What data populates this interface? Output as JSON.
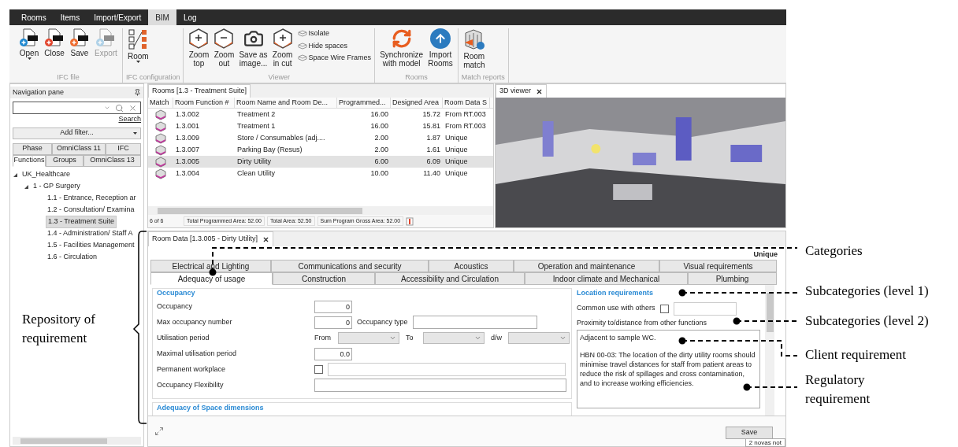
{
  "app_tabs": [
    {
      "label": "Rooms",
      "selected": false
    },
    {
      "label": "Items",
      "selected": false
    },
    {
      "label": "Import/Export",
      "selected": false
    },
    {
      "label": "BIM",
      "selected": true
    },
    {
      "label": "Log",
      "selected": false
    }
  ],
  "ribbon": {
    "groups": [
      {
        "title": "IFC file",
        "buttons": [
          {
            "label": "Open",
            "dropdown": true,
            "disabled": false
          },
          {
            "label": "Close",
            "dropdown": false,
            "disabled": false
          },
          {
            "label": "Save",
            "dropdown": false,
            "disabled": false
          },
          {
            "label": "Export",
            "dropdown": false,
            "disabled": true
          }
        ]
      },
      {
        "title": "IFC configuration",
        "buttons": [
          {
            "label": "Room",
            "dropdown": true,
            "disabled": false
          }
        ]
      },
      {
        "title": "Viewer",
        "buttons": [
          {
            "label": "Zoom\ntop",
            "dropdown": false,
            "disabled": false
          },
          {
            "label": "Zoom\nout",
            "dropdown": false,
            "disabled": false
          },
          {
            "label": "Save as\nimage...",
            "dropdown": false,
            "disabled": false
          },
          {
            "label": "Zoom\nin cut",
            "dropdown": false,
            "disabled": false
          }
        ],
        "small_buttons": [
          "Isolate",
          "Hide spaces",
          "Space Wire Frames"
        ]
      },
      {
        "title": "Rooms",
        "buttons": [
          {
            "label": "Synchronize\nwith model",
            "dropdown": false,
            "disabled": false
          },
          {
            "label": "Import\nRooms",
            "dropdown": false,
            "disabled": false
          }
        ]
      },
      {
        "title": "Match reports",
        "buttons": [
          {
            "label": "Room\nmatch",
            "dropdown": false,
            "disabled": false
          }
        ]
      }
    ]
  },
  "nav": {
    "title": "Navigation pane",
    "search_link": "Search",
    "filter": "Add filter...",
    "tabs_row1": [
      {
        "label": "Phase",
        "selected": false
      },
      {
        "label": "OmniClass 11",
        "selected": false
      },
      {
        "label": "IFC",
        "selected": false
      }
    ],
    "tabs_row2": [
      {
        "label": "Functions",
        "selected": true
      },
      {
        "label": "Groups",
        "selected": false
      },
      {
        "label": "OmniClass 13",
        "selected": false
      }
    ],
    "tree": [
      {
        "label": "UK_Healthcare",
        "expanded": true,
        "selected": false,
        "children": [
          {
            "label": "1 - GP Surgery",
            "expanded": true,
            "selected": false,
            "children": [
              {
                "label": "1.1 - Entrance, Reception ar",
                "selected": false
              },
              {
                "label": "1.2 - Consultation/ Examina",
                "selected": false
              },
              {
                "label": "1.3 - Treatment Suite",
                "selected": true
              },
              {
                "label": "1.4 - Administration/ Staff A",
                "selected": false
              },
              {
                "label": "1.5 - Facilities Management",
                "selected": false
              },
              {
                "label": "1.6 - Circulation",
                "selected": false
              }
            ]
          }
        ]
      }
    ]
  },
  "rooms_panel": {
    "tab": "Rooms [1.3 - Treatment Suite]",
    "columns": [
      "Match",
      "Room Function #",
      "Room Name and Room De...",
      "Programmed...",
      "Designed Area",
      "Room Data S"
    ],
    "rows": [
      {
        "cells": [
          "",
          "1.3.002",
          "Treatment 2",
          "16.00",
          "15.72",
          "From RT.003"
        ],
        "selected": false
      },
      {
        "cells": [
          "",
          "1.3.001",
          "Treatment 1",
          "16.00",
          "15.81",
          "From RT.003"
        ],
        "selected": false
      },
      {
        "cells": [
          "",
          "1.3.009",
          "Store / Consumables (adj....",
          "2.00",
          "1.87",
          "Unique"
        ],
        "selected": false
      },
      {
        "cells": [
          "",
          "1.3.007",
          "Parking Bay (Resus)",
          "2.00",
          "1.61",
          "Unique"
        ],
        "selected": false
      },
      {
        "cells": [
          "",
          "1.3.005",
          "Dirty Utility",
          "6.00",
          "6.09",
          "Unique"
        ],
        "selected": true
      },
      {
        "cells": [
          "",
          "1.3.004",
          "Clean Utility",
          "10.00",
          "11.40",
          "Unique"
        ],
        "selected": false
      }
    ],
    "count": "6 of 6",
    "totals": [
      "Total Programmed Area: 52.00",
      "Total Area: 52.50",
      "Sum Program Gross Area: 52.00"
    ]
  },
  "viewer": {
    "tab": "3D viewer"
  },
  "room_data": {
    "tab": "Room Data [1.3.005 - Dirty Utility]",
    "source": "Unique",
    "tabs_row1": [
      {
        "label": "Electrical and Lighting",
        "selected": false
      },
      {
        "label": "Communications and security",
        "selected": false
      },
      {
        "label": "Acoustics",
        "selected": false
      },
      {
        "label": "Operation and maintenance",
        "selected": false
      },
      {
        "label": "Visual requirements",
        "selected": false
      }
    ],
    "tabs_row2": [
      {
        "label": "Adequacy of usage",
        "selected": true
      },
      {
        "label": "Construction",
        "selected": false
      },
      {
        "label": "Accessibility and Circulation",
        "selected": false
      },
      {
        "label": "Indoor climate and Mechanical",
        "selected": false
      },
      {
        "label": "Plumbing",
        "selected": false
      }
    ],
    "occupancy": {
      "title": "Occupancy",
      "fields": [
        {
          "kind": "number",
          "label": "Occupancy",
          "value": "0"
        },
        {
          "kind": "number_type",
          "label": "Max occupancy number",
          "value": "0",
          "extra_label": "Occupancy type"
        },
        {
          "kind": "period",
          "label": "Utilisation period",
          "selects": [
            "From",
            "To",
            "d/w"
          ]
        },
        {
          "kind": "number",
          "label": "Maximal utilisation period",
          "value": "0.0"
        },
        {
          "kind": "check_text",
          "label": "Permanent workplace",
          "checked": false
        },
        {
          "kind": "text",
          "label": "Occupancy Flexibility"
        }
      ]
    },
    "next_section": "Adequacy of Space dimensions",
    "location": {
      "title": "Location requirements",
      "common_use": {
        "label": "Common use with others",
        "checked": false
      },
      "proximity_label": "Proximity to/distance from other functions",
      "proximity_text": [
        "Adjacent to sample WC.",
        "HBN 00-03: The location of the dirty utility rooms should minimise travel distances for staff from patient areas to reduce the risk of spillages and cross contamination, and to increase working efficiencies."
      ]
    },
    "save": "Save",
    "notification": "2 novas not"
  },
  "annotations": {
    "right": [
      "Categories",
      "Subcategories (level 1)",
      "Subcategories (level 2)",
      "Client requirement",
      "Regulatory requirement"
    ],
    "left": "Repository of requirement"
  }
}
